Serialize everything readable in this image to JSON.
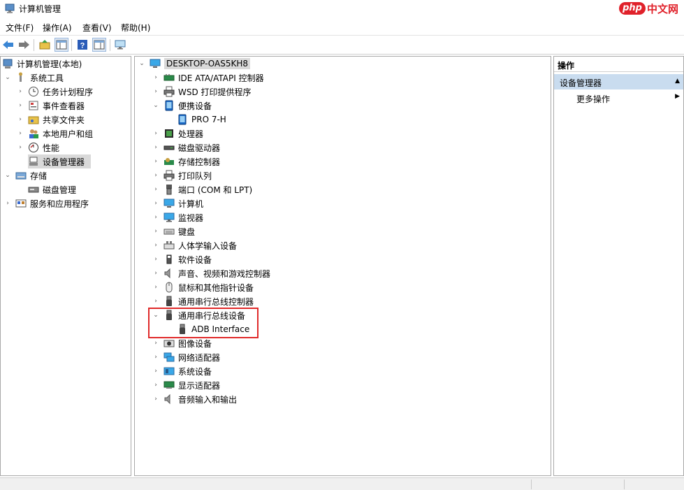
{
  "window": {
    "title": "计算机管理"
  },
  "watermark": {
    "brand": "php",
    "text": "中文网"
  },
  "menu": [
    "文件(F)",
    "操作(A)",
    "查看(V)",
    "帮助(H)"
  ],
  "toolbar": {
    "buttons": [
      "back-icon",
      "forward-icon",
      "up-folder-icon",
      "show-hide-tree-icon",
      "help-icon",
      "properties-icon",
      "monitor-icon"
    ]
  },
  "left_tree": [
    {
      "label": "计算机管理(本地)",
      "icon": "computer-management-icon",
      "expander": "",
      "level": 0
    },
    {
      "label": "系统工具",
      "icon": "tools-icon",
      "expander": "expanded",
      "level": 1
    },
    {
      "label": "任务计划程序",
      "icon": "clock-icon",
      "expander": "collapsed",
      "level": 2
    },
    {
      "label": "事件查看器",
      "icon": "event-viewer-icon",
      "expander": "collapsed",
      "level": 2
    },
    {
      "label": "共享文件夹",
      "icon": "shared-folder-icon",
      "expander": "collapsed",
      "level": 2
    },
    {
      "label": "本地用户和组",
      "icon": "users-icon",
      "expander": "collapsed",
      "level": 2
    },
    {
      "label": "性能",
      "icon": "performance-icon",
      "expander": "collapsed",
      "level": 2
    },
    {
      "label": "设备管理器",
      "icon": "device-manager-icon",
      "expander": "",
      "level": 2,
      "selected": true
    },
    {
      "label": "存储",
      "icon": "storage-icon",
      "expander": "expanded",
      "level": 1
    },
    {
      "label": "磁盘管理",
      "icon": "disk-management-icon",
      "expander": "",
      "level": 2
    },
    {
      "label": "服务和应用程序",
      "icon": "services-icon",
      "expander": "collapsed",
      "level": 1
    }
  ],
  "device_tree": [
    {
      "label": "DESKTOP-OAS5KH8",
      "icon": "computer-icon",
      "expander": "expanded",
      "level": 0,
      "selected": true
    },
    {
      "label": "IDE ATA/ATAPI 控制器",
      "icon": "ide-controller-icon",
      "expander": "collapsed",
      "level": 1
    },
    {
      "label": "WSD 打印提供程序",
      "icon": "printer-icon",
      "expander": "collapsed",
      "level": 1
    },
    {
      "label": "便携设备",
      "icon": "portable-device-icon",
      "expander": "expanded",
      "level": 1
    },
    {
      "label": "PRO 7-H",
      "icon": "portable-device-icon",
      "expander": "",
      "level": 2
    },
    {
      "label": "处理器",
      "icon": "processor-icon",
      "expander": "collapsed",
      "level": 1
    },
    {
      "label": "磁盘驱动器",
      "icon": "disk-drive-icon",
      "expander": "collapsed",
      "level": 1
    },
    {
      "label": "存储控制器",
      "icon": "storage-controller-icon",
      "expander": "collapsed",
      "level": 1
    },
    {
      "label": "打印队列",
      "icon": "printer-icon",
      "expander": "collapsed",
      "level": 1
    },
    {
      "label": "端口 (COM 和 LPT)",
      "icon": "port-icon",
      "expander": "collapsed",
      "level": 1
    },
    {
      "label": "计算机",
      "icon": "computer-icon",
      "expander": "collapsed",
      "level": 1
    },
    {
      "label": "监视器",
      "icon": "monitor-icon",
      "expander": "collapsed",
      "level": 1
    },
    {
      "label": "键盘",
      "icon": "keyboard-icon",
      "expander": "collapsed",
      "level": 1
    },
    {
      "label": "人体学输入设备",
      "icon": "hid-icon",
      "expander": "collapsed",
      "level": 1
    },
    {
      "label": "软件设备",
      "icon": "software-device-icon",
      "expander": "collapsed",
      "level": 1
    },
    {
      "label": "声音、视频和游戏控制器",
      "icon": "speaker-icon",
      "expander": "collapsed",
      "level": 1
    },
    {
      "label": "鼠标和其他指针设备",
      "icon": "mouse-icon",
      "expander": "collapsed",
      "level": 1
    },
    {
      "label": "通用串行总线控制器",
      "icon": "usb-icon",
      "expander": "collapsed",
      "level": 1
    },
    {
      "label": "通用串行总线设备",
      "icon": "usb-icon",
      "expander": "expanded",
      "level": 1
    },
    {
      "label": "ADB Interface",
      "icon": "usb-icon",
      "expander": "",
      "level": 2
    },
    {
      "label": "图像设备",
      "icon": "camera-icon",
      "expander": "collapsed",
      "level": 1
    },
    {
      "label": "网络适配器",
      "icon": "network-adapter-icon",
      "expander": "collapsed",
      "level": 1
    },
    {
      "label": "系统设备",
      "icon": "system-device-icon",
      "expander": "collapsed",
      "level": 1
    },
    {
      "label": "显示适配器",
      "icon": "display-adapter-icon",
      "expander": "collapsed",
      "level": 1
    },
    {
      "label": "音频输入和输出",
      "icon": "speaker-icon",
      "expander": "collapsed",
      "level": 1
    }
  ],
  "actions": {
    "header": "操作",
    "section": "设备管理器",
    "more": "更多操作"
  },
  "colors": {
    "highlight": "#e02a2a",
    "actions_section_bg": "#c9dcef"
  }
}
